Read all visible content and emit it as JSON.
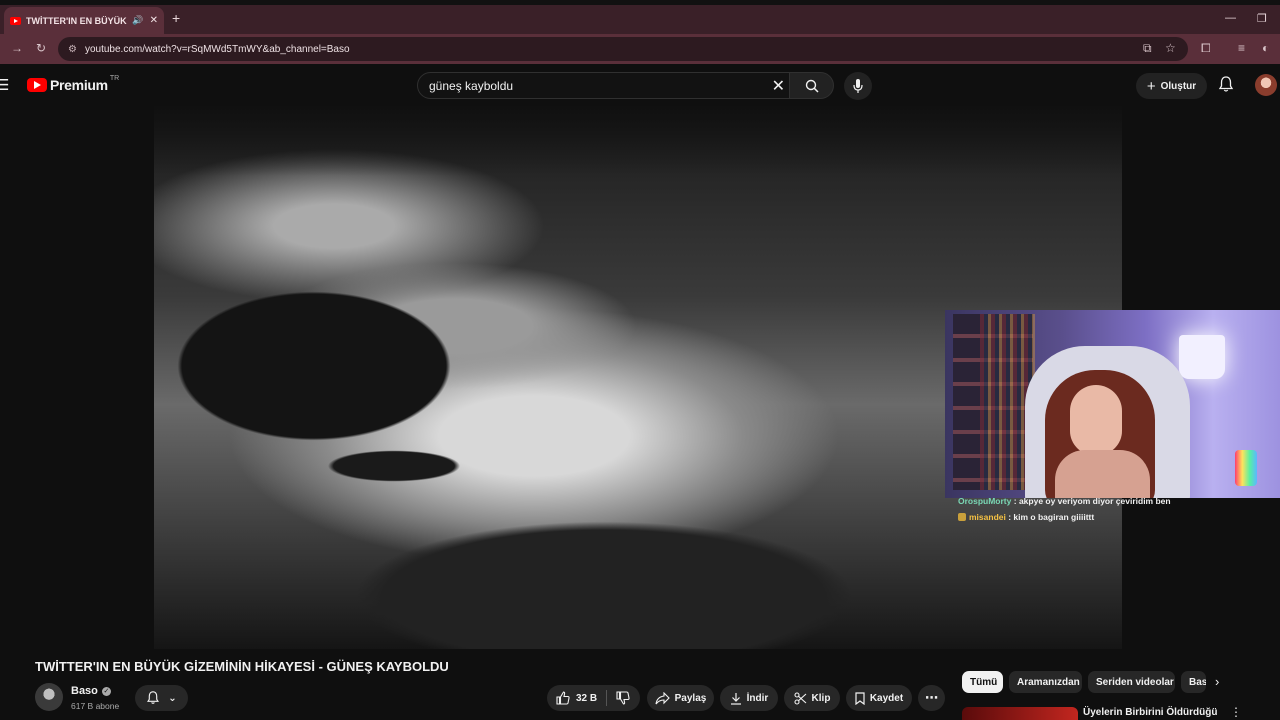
{
  "browser": {
    "tab_title": "TWİTTER'IN EN BÜYÜK GİZEMİNİN HİKAYESİ - GÜNEŞ KAYBOLDU",
    "url": "youtube.com/watch?v=rSqMWd5TmWY&ab_channel=Baso"
  },
  "header": {
    "logo_text": "Premium",
    "country_code": "TR",
    "search_query": "güneş kayboldu",
    "create_label": "Oluştur"
  },
  "chat": [
    {
      "user": "OrospuMorty",
      "message": ": akpye oy veriyom diyor çeviridim ben"
    },
    {
      "user": "misandei",
      "message": ": kim o bagiran giiiittt"
    }
  ],
  "video": {
    "title": "TWİTTER'IN EN BÜYÜK GİZEMİNİN HİKAYESİ - GÜNEŞ KAYBOLDU",
    "channel": "Baso",
    "subscribers": "617 B abone",
    "likes": "32 B",
    "share_label": "Paylaş",
    "download_label": "İndir",
    "clip_label": "Klip",
    "save_label": "Kaydet"
  },
  "chips": [
    "Tümü",
    "Aramanızdan",
    "Seriden videolar",
    "Baso"
  ],
  "recommendation": {
    "title": "Üyelerin Birbirini Öldürdüğü"
  }
}
